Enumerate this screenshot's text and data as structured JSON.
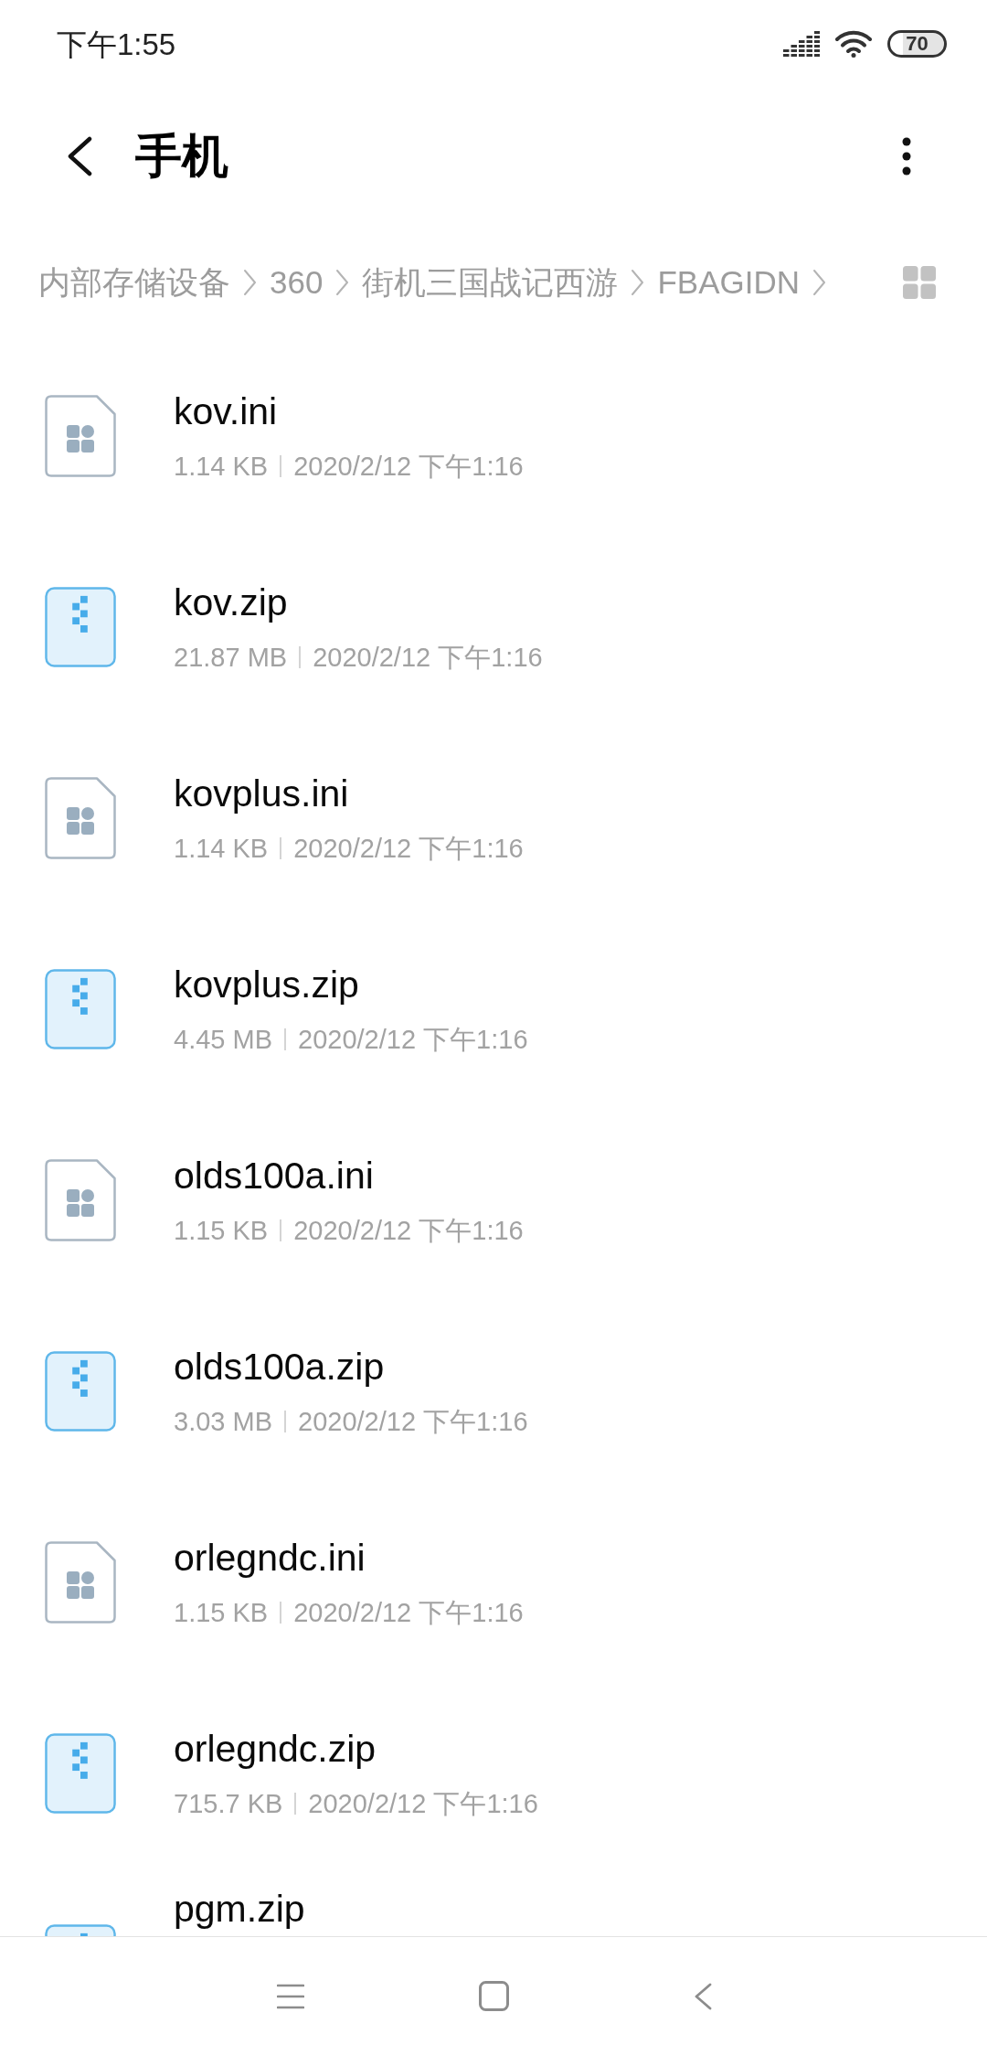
{
  "status_bar": {
    "time": "下午1:55",
    "battery": "70"
  },
  "header": {
    "title": "手机"
  },
  "breadcrumb": {
    "items": [
      "内部存储设备",
      "360",
      "街机三国战记西游",
      "FBAGIDN"
    ]
  },
  "files": [
    {
      "kind": "ini",
      "name": "kov.ini",
      "size": "1.14 KB",
      "date": "2020/2/12 下午1:16"
    },
    {
      "kind": "zip",
      "name": "kov.zip",
      "size": "21.87 MB",
      "date": "2020/2/12 下午1:16"
    },
    {
      "kind": "ini",
      "name": "kovplus.ini",
      "size": "1.14 KB",
      "date": "2020/2/12 下午1:16"
    },
    {
      "kind": "zip",
      "name": "kovplus.zip",
      "size": "4.45 MB",
      "date": "2020/2/12 下午1:16"
    },
    {
      "kind": "ini",
      "name": "olds100a.ini",
      "size": "1.15 KB",
      "date": "2020/2/12 下午1:16"
    },
    {
      "kind": "zip",
      "name": "olds100a.zip",
      "size": "3.03 MB",
      "date": "2020/2/12 下午1:16"
    },
    {
      "kind": "ini",
      "name": "orlegndc.ini",
      "size": "1.15 KB",
      "date": "2020/2/12 下午1:16"
    },
    {
      "kind": "zip",
      "name": "orlegndc.zip",
      "size": "715.7 KB",
      "date": "2020/2/12 下午1:16"
    },
    {
      "kind": "zip",
      "name": "pgm.zip"
    }
  ]
}
